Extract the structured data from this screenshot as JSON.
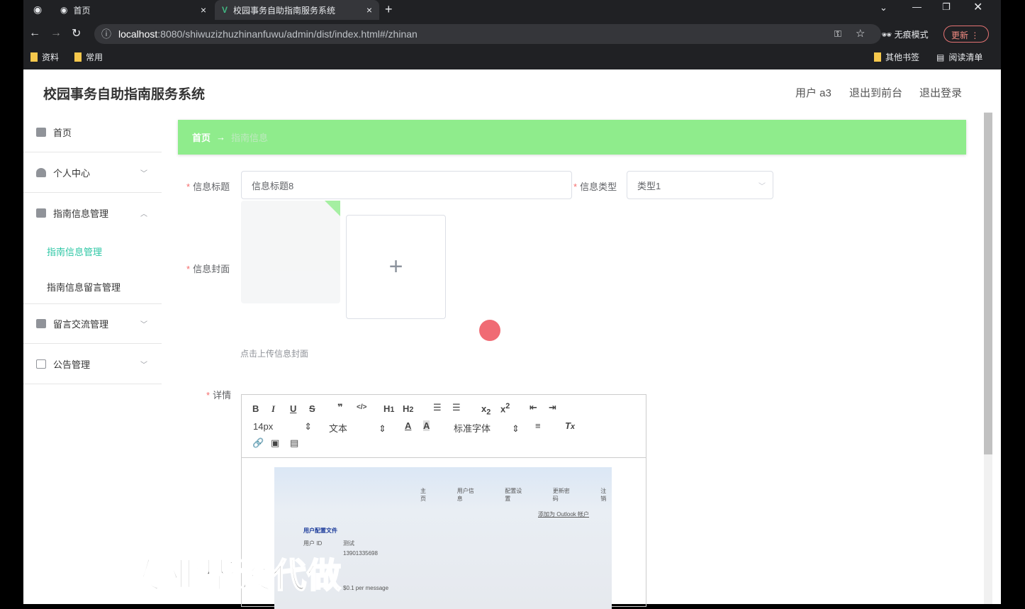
{
  "browser": {
    "tabs": [
      {
        "label": "首页"
      },
      {
        "label": "校园事务自助指南服务系统"
      }
    ],
    "url_host": "localhost",
    "url_rest": ":8080/shiwuzizhuzhinanfuwu/admin/dist/index.html#/zhinan",
    "incognito": "无痕模式",
    "update": "更新",
    "bookmarks": [
      "资料",
      "常用"
    ],
    "other_bookmarks": "其他书签",
    "reading_list": "阅读清单"
  },
  "header": {
    "title": "校园事务自助指南服务系统",
    "user": "用户 a3",
    "front": "退出到前台",
    "logout": "退出登录"
  },
  "sidebar": {
    "items": [
      {
        "label": "首页"
      },
      {
        "label": "个人中心"
      },
      {
        "label": "指南信息管理"
      },
      {
        "label": "留言交流管理"
      },
      {
        "label": "公告管理"
      }
    ],
    "sub": [
      "指南信息管理",
      "指南信息留言管理"
    ]
  },
  "breadcrumb": {
    "home": "首页",
    "arrow": "→",
    "current": "指南信息"
  },
  "form": {
    "title_label": "信息标题",
    "title_value": "信息标题8",
    "type_label": "信息类型",
    "type_value": "类型1",
    "cover_label": "信息封面",
    "cover_hint": "点击上传信息封面",
    "detail_label": "详情"
  },
  "editor": {
    "font_size": "14px",
    "block": "文本",
    "font": "标准字体",
    "content": {
      "nav": [
        "主页",
        "用户信息",
        "配置设置",
        "更新密码",
        "注销"
      ],
      "outlook": "添加为 Outlook 帐户",
      "profile": "用户配置文件",
      "uid_label": "用户 ID",
      "uid": "测试",
      "phone": "13901335698",
      "price": "$0.1 per message"
    }
  },
  "watermark": "专业毕设代做"
}
